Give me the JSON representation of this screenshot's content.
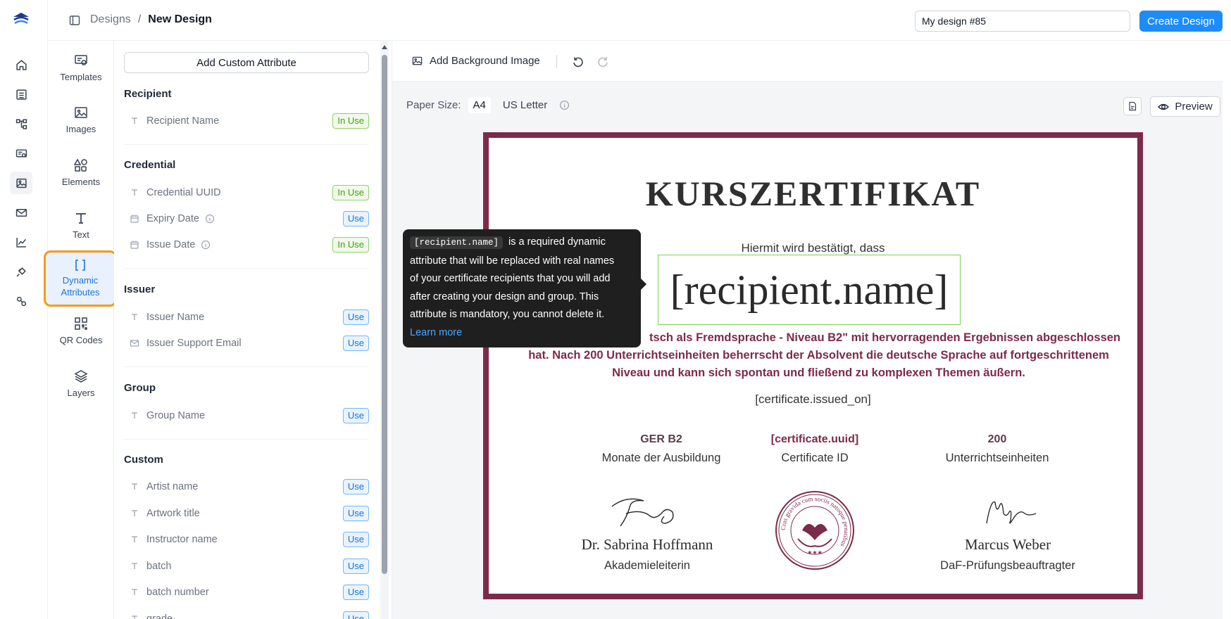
{
  "header": {
    "breadcrumb_root": "Designs",
    "breadcrumb_sep": "/",
    "breadcrumb_current": "New Design",
    "design_name": "My design #85",
    "create_label": "Create Design"
  },
  "tools": [
    {
      "label": "Templates"
    },
    {
      "label": "Images"
    },
    {
      "label": "Elements"
    },
    {
      "label": "Text"
    },
    {
      "label": "Dynamic Attributes"
    },
    {
      "label": "QR Codes"
    },
    {
      "label": "Layers"
    }
  ],
  "attributes": {
    "add_label": "Add Custom Attribute",
    "groups": [
      {
        "title": "Recipient",
        "items": [
          {
            "label": "Recipient Name",
            "badge": "In Use"
          }
        ]
      },
      {
        "title": "Credential",
        "items": [
          {
            "label": "Credential UUID",
            "badge": "In Use"
          },
          {
            "label": "Expiry Date",
            "badge": "Use"
          },
          {
            "label": "Issue Date",
            "badge": "In Use"
          }
        ]
      },
      {
        "title": "Issuer",
        "items": [
          {
            "label": "Issuer Name",
            "badge": "Use"
          },
          {
            "label": "Issuer Support Email",
            "badge": "Use"
          }
        ]
      },
      {
        "title": "Group",
        "items": [
          {
            "label": "Group Name",
            "badge": "Use"
          }
        ]
      },
      {
        "title": "Custom",
        "items": [
          {
            "label": "Artist name",
            "badge": "Use"
          },
          {
            "label": "Artwork title",
            "badge": "Use"
          },
          {
            "label": "Instructor name",
            "badge": "Use"
          },
          {
            "label": "batch",
            "badge": "Use"
          },
          {
            "label": "batch number",
            "badge": "Use"
          },
          {
            "label": "grade",
            "badge": "Use"
          }
        ]
      }
    ]
  },
  "editor": {
    "add_bg_label": "Add Background Image",
    "paper_size_label": "Paper Size:",
    "paper_a4": "A4",
    "paper_us": "US Letter",
    "preview_label": "Preview"
  },
  "certificate": {
    "title": "KURSZERTIFIKAT",
    "intro": "Hiermit wird bestätigt, dass",
    "recipient": "[recipient.name]",
    "desc_line1": "tsch als Fremdsprache - Niveau B2\" mit hervorragenden Ergebnissen abgeschlossen",
    "desc_line2": "hat. Nach 200 Unterrichtseinheiten beherrscht der Absolvent die deutsche Sprache auf fortgeschrittenem",
    "desc_line3": "Niveau und kann sich spontan und fließend zu komplexen Themen äußern.",
    "issued": "[certificate.issued_on]",
    "stats": [
      {
        "value": "GER B2",
        "label": "Monate der Ausbildung"
      },
      {
        "value": "[certificate.uuid]",
        "label": "Certificate ID"
      },
      {
        "value": "200",
        "label": "Unterrichtseinheiten"
      }
    ],
    "signatories": [
      {
        "name": "Dr. Sabrina Hoffmann",
        "role": "Akademieleiterin"
      },
      {
        "name": "Marcus Weber",
        "role": "DaF-Prüfungsbeauftragter"
      }
    ],
    "seal_text": "Cras gravida cum sociis natoque penatibus",
    "seal_stars": "★★★"
  },
  "tooltip": {
    "code": "[recipient.name]",
    "line1": "is a required dynamic",
    "line2": "attribute that will be replaced with real names",
    "line3": "of your certificate recipients that you will add",
    "line4": "after creating your design and group. This",
    "line5": "attribute is mandatory, you cannot delete it.",
    "link": "Learn more"
  },
  "colors": {
    "brand_blue": "#1d8cf8",
    "cert_border": "#7d2a4a",
    "highlight_orange": "#f29b1d",
    "selection_green": "#7dd15a"
  }
}
